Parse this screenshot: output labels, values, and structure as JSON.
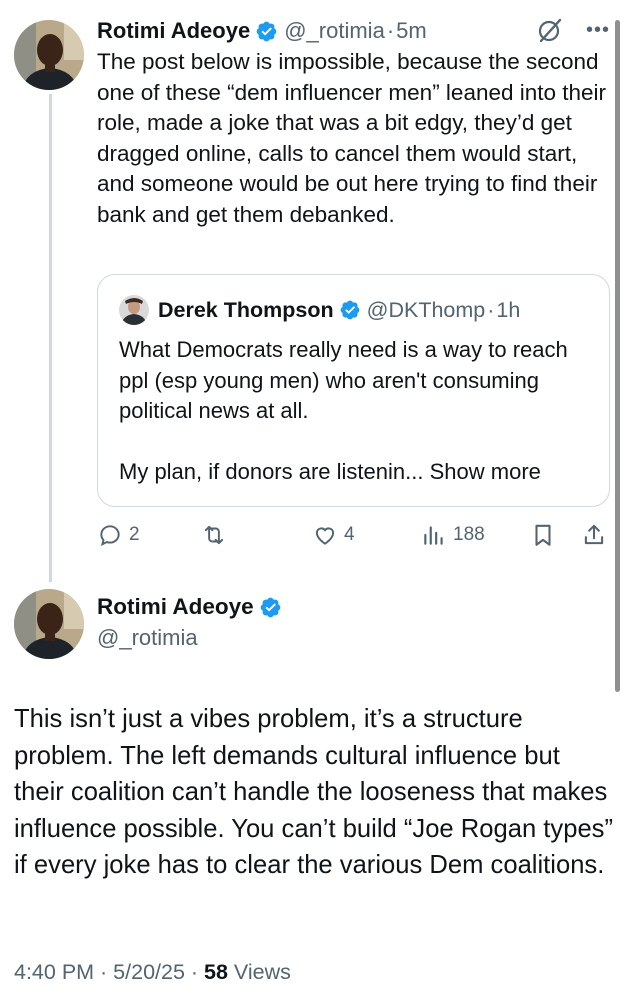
{
  "post1": {
    "author_name": "Rotimi Adeoye",
    "handle": "@_rotimia",
    "separator": "·",
    "time": "5m",
    "text": "The post below is impossible, because the second one of these “dem influencer men” leaned into their role, made a joke that was a bit edgy, they’d get dragged online, calls to cancel them would start, and someone would be out here trying to find their bank and get them debanked.",
    "more_icon": "•••",
    "quote": {
      "author_name": "Derek Thompson",
      "handle": "@DKThomp",
      "separator": "·",
      "time": "1h",
      "text_line1": "What Democrats really need is a way to reach ppl (esp young men) who aren't consuming political news at all.",
      "text_line2": "My plan, if donors are listenin...",
      "show_more": "Show more"
    },
    "actions": {
      "replies": "2",
      "reposts": "",
      "likes": "4",
      "views": "188"
    }
  },
  "post2": {
    "author_name": "Rotimi Adeoye",
    "handle": "@_rotimia",
    "text": "This isn’t just a vibes problem, it’s a structure problem. The left demands cultural influence but their coalition can’t handle the looseness that makes influence possible. You can’t build “Joe Rogan types” if every joke has to clear the various Dem coalitions.",
    "timestamp": "4:40 PM · 5/20/25 · ",
    "views_count": "58",
    "views_label": " Views"
  },
  "colors": {
    "verified": "#1d9bf0",
    "secondary_text": "#536471",
    "border": "#cfd9de",
    "primary_text": "#0f1419"
  },
  "icons": {
    "verified": "verified-badge-icon",
    "grok": "grok-icon",
    "more": "more-icon",
    "reply": "reply-icon",
    "repost": "repost-icon",
    "like": "like-icon",
    "views": "views-icon",
    "bookmark": "bookmark-icon",
    "share": "share-icon"
  }
}
